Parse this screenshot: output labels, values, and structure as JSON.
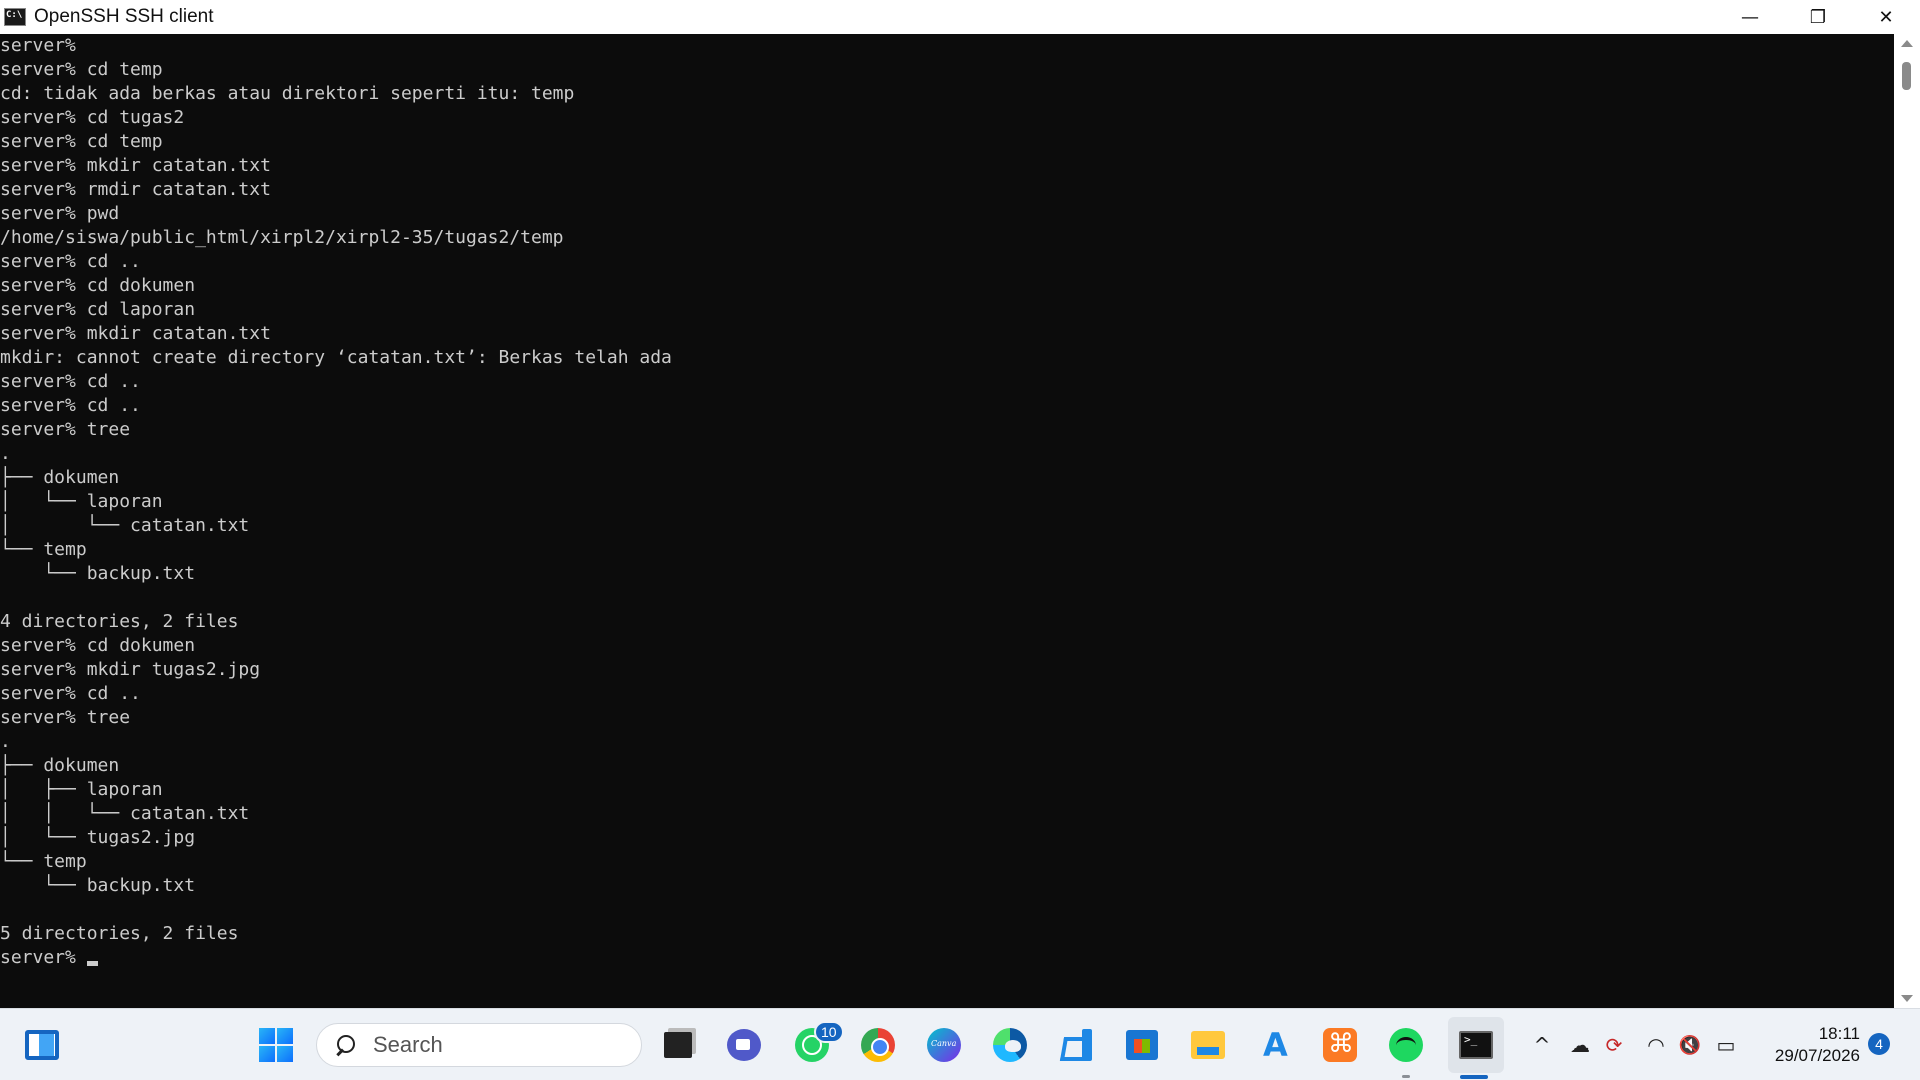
{
  "window": {
    "title": "OpenSSH SSH client",
    "minimize_glyph": "—",
    "restore_glyph": "❐",
    "close_glyph": "✕"
  },
  "terminal": {
    "lines": [
      "server%",
      "server% cd temp",
      "cd: tidak ada berkas atau direktori seperti itu: temp",
      "server% cd tugas2",
      "server% cd temp",
      "server% mkdir catatan.txt",
      "server% rmdir catatan.txt",
      "server% pwd",
      "/home/siswa/public_html/xirpl2/xirpl2-35/tugas2/temp",
      "server% cd ..",
      "server% cd dokumen",
      "server% cd laporan",
      "server% mkdir catatan.txt",
      "mkdir: cannot create directory ‘catatan.txt’: Berkas telah ada",
      "server% cd ..",
      "server% cd ..",
      "server% tree",
      ".",
      "├── dokumen",
      "│   └── laporan",
      "│       └── catatan.txt",
      "└── temp",
      "    └── backup.txt",
      "",
      "4 directories, 2 files",
      "server% cd dokumen",
      "server% mkdir tugas2.jpg",
      "server% cd ..",
      "server% tree",
      ".",
      "├── dokumen",
      "│   ├── laporan",
      "│   │   └── catatan.txt",
      "│   └── tugas2.jpg",
      "└── temp",
      "    └── backup.txt",
      "",
      "5 directories, 2 files"
    ],
    "prompt": "server% "
  },
  "taskbar": {
    "search_placeholder": "Search",
    "whatsapp_badge": "10",
    "apps": [
      "widgets-icon",
      "start-icon",
      "task-view-icon",
      "meet-icon",
      "whatsapp-icon",
      "chrome-icon",
      "canva-icon",
      "edge-icon",
      "vscode-icon",
      "microsoft-store-icon",
      "file-explorer-icon",
      "arc-icon",
      "xampp-icon",
      "spotify-icon",
      "terminal-icon"
    ]
  },
  "tray": {
    "chevron": "^",
    "cloud_glyph": "☁",
    "sync_glyph": "⟳",
    "wifi_glyph": "◠",
    "volume_glyph": "🔇",
    "battery_glyph": "▭",
    "time": "18:11",
    "date": "29/07/2026",
    "notification_count": "4"
  },
  "colors": {
    "terminal_bg": "#0c0c0c",
    "terminal_fg": "#cccccc",
    "accent": "#1565c0"
  }
}
